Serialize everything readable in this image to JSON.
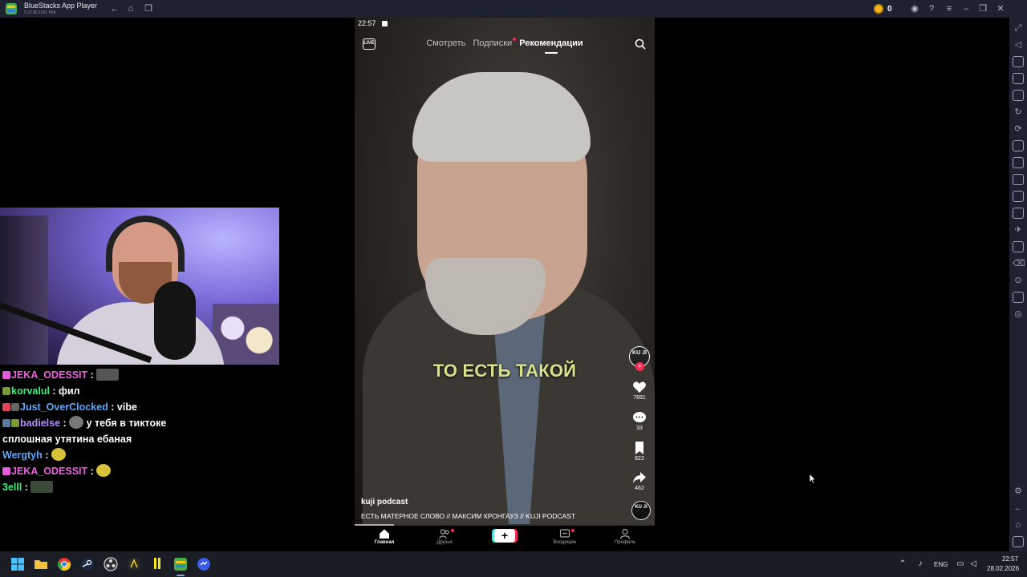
{
  "window": {
    "app_title": "BlueStacks App Player",
    "version": "5.22.86.1001  P64",
    "coin_count": "0"
  },
  "chat": {
    "messages": [
      {
        "user": "JEKA_ODESSIT",
        "user_color": "#f060e0",
        "text": "",
        "has_emote": true
      },
      {
        "user": "korvalul",
        "user_color": "#3cf07a",
        "text": "фил",
        "has_emote": false
      },
      {
        "user": "Just_OverClocked",
        "user_color": "#5aa8ff",
        "text": "vibe",
        "has_emote": false
      },
      {
        "user": "badielse",
        "user_color": "#b48cff",
        "text": "у тебя в тиктоке",
        "has_emote": true
      },
      {
        "user": "",
        "user_color": "#fff",
        "text": "сплошная утятина ебаная",
        "has_emote": false
      },
      {
        "user": "Wergtyh",
        "user_color": "#5aa8ff",
        "text": "",
        "has_emote": true
      },
      {
        "user": "JEKA_ODESSIT",
        "user_color": "#f060e0",
        "text": "",
        "has_emote": true
      },
      {
        "user": "3elll",
        "user_color": "#3cf07a",
        "text": "",
        "has_emote": true
      }
    ]
  },
  "phone": {
    "time": "22:57",
    "live_label": "LIVE",
    "tabs": {
      "watch": "Смотреть",
      "following": "Подписки",
      "for_you": "Рекомендации"
    },
    "caption": "ТО ЕСТЬ ТАКОЙ",
    "avatar_text": "KU JI",
    "likes": "7691",
    "comments": "33",
    "bookmarks": "822",
    "shares": "462",
    "author": "kuji podcast",
    "description": "ЕСТЬ МАТЕРНОЕ СЛОВО // МАКСИМ КРОНГАУЗ // KUJI PODCAST",
    "progress": 0.13,
    "nav": {
      "home": "Главная",
      "friends": "Друзья",
      "create": "+",
      "inbox": "Входящие",
      "profile": "Профиль"
    }
  },
  "taskbar": {
    "lang": "ENG",
    "time": "22:57",
    "date": "28.02.2026"
  },
  "colors": {
    "tiktok_red": "#fe2c55",
    "tiktok_cyan": "#25f4ee",
    "bluestacks_bar": "#1e2230",
    "caption_yellow": "#d9e28a"
  }
}
